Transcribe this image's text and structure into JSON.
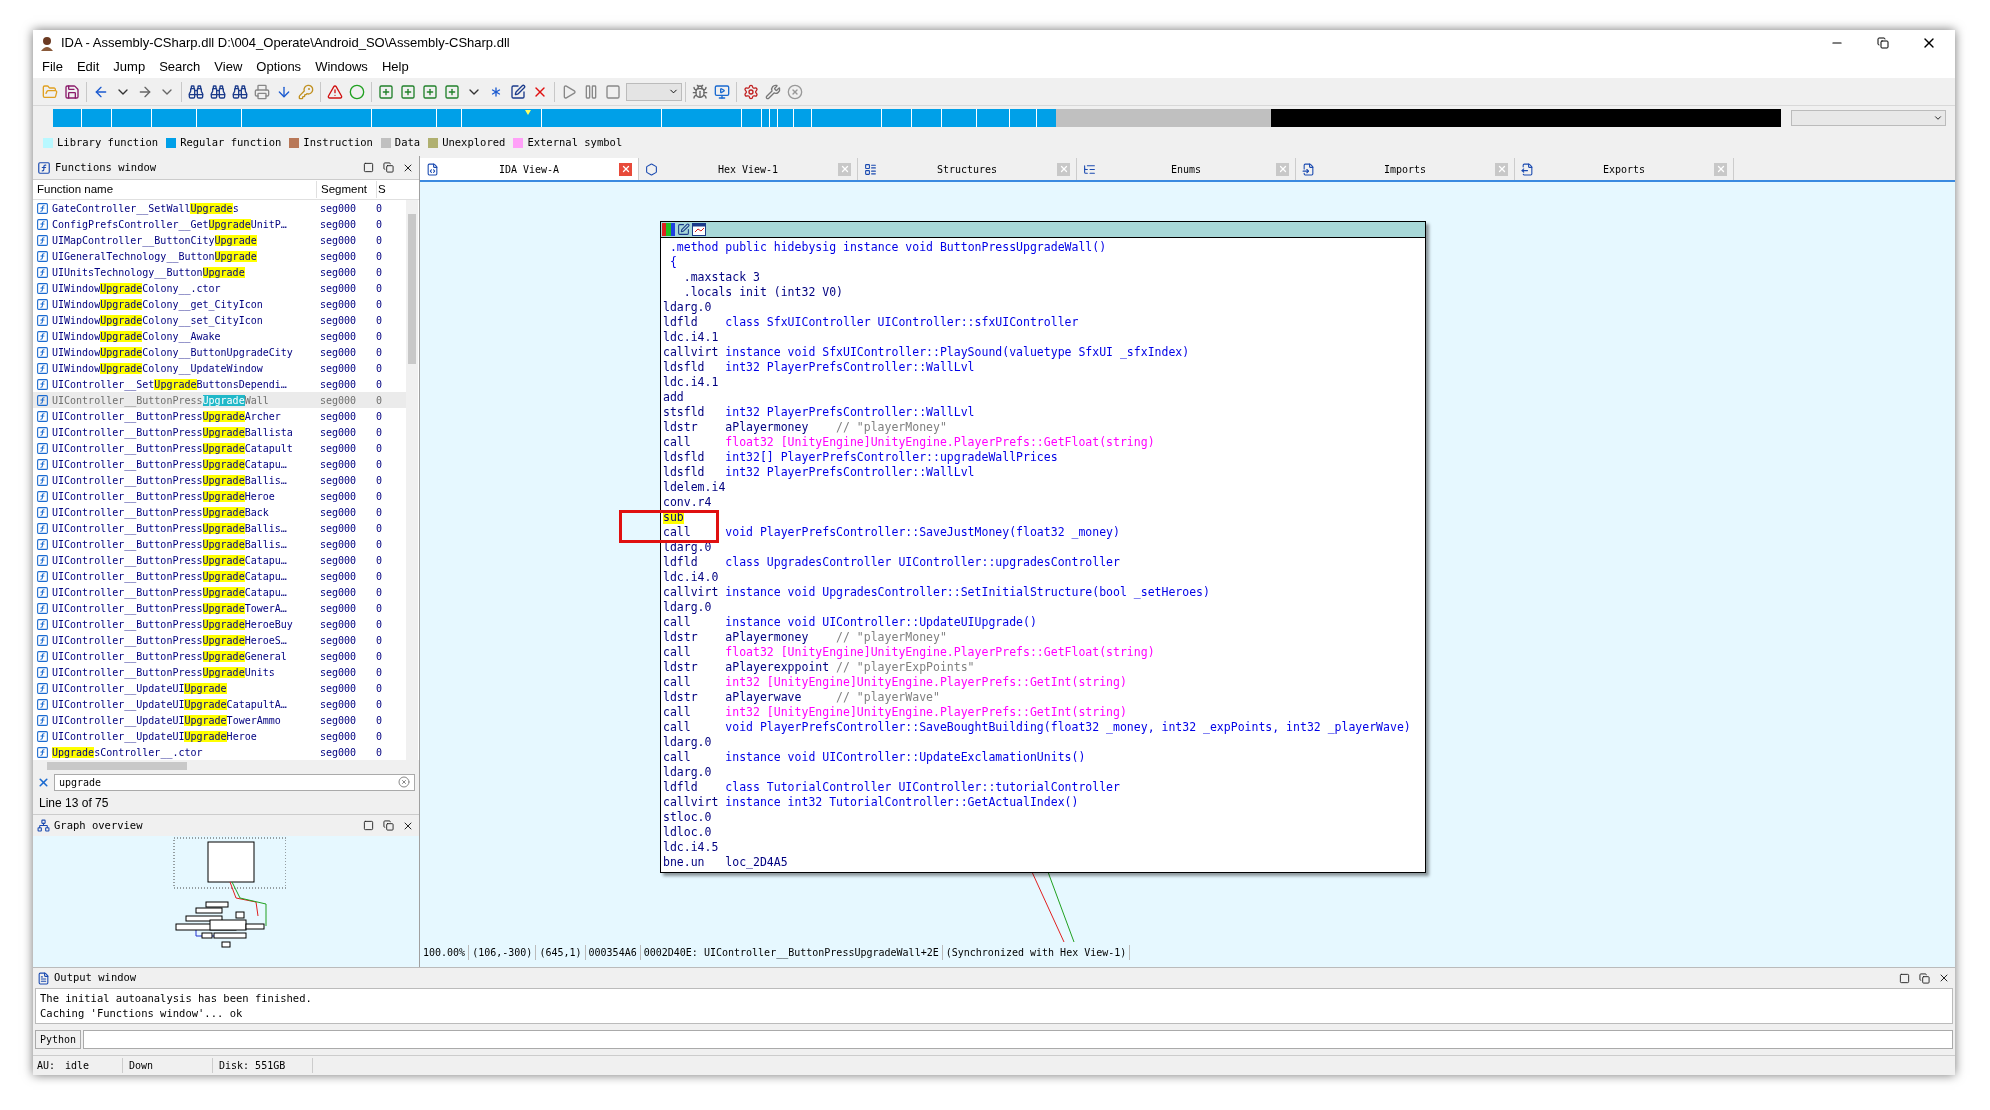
{
  "window": {
    "title": "IDA - Assembly-CSharp.dll D:\\004_Operate\\Android_SO\\Assembly-CSharp.dll"
  },
  "menu": [
    "File",
    "Edit",
    "Jump",
    "Search",
    "View",
    "Options",
    "Windows",
    "Help"
  ],
  "legend": [
    {
      "label": "Library function",
      "color": "#b8f8ff"
    },
    {
      "label": "Regular function",
      "color": "#00a0e8"
    },
    {
      "label": "Instruction",
      "color": "#b87858"
    },
    {
      "label": "Data",
      "color": "#c0c0c0"
    },
    {
      "label": "Unexplored",
      "color": "#b0b070"
    },
    {
      "label": "External symbol",
      "color": "#ffa0f8"
    }
  ],
  "functions_window": {
    "title": "Functions window",
    "columns": [
      "Function name",
      "Segment",
      "S"
    ],
    "rows": [
      {
        "parts": [
          {
            "text": "GateController__SetWall",
            "match": false
          },
          {
            "text": "Upgrade",
            "match": true
          },
          {
            "text": "s",
            "match": false
          }
        ],
        "segment": "seg000",
        "column_3": "0",
        "selected": false
      },
      {
        "parts": [
          {
            "text": "ConfigPrefsController__Get",
            "match": false
          },
          {
            "text": "Upgrade",
            "match": true
          },
          {
            "text": "UnitP…",
            "match": false
          }
        ],
        "segment": "seg000",
        "column_3": "0",
        "selected": false
      },
      {
        "parts": [
          {
            "text": "UIMapController__ButtonCity",
            "match": false
          },
          {
            "text": "Upgrade",
            "match": true
          }
        ],
        "segment": "seg000",
        "column_3": "0",
        "selected": false
      },
      {
        "parts": [
          {
            "text": "UIGeneralTechnology__Button",
            "match": false
          },
          {
            "text": "Upgrade",
            "match": true
          }
        ],
        "segment": "seg000",
        "column_3": "0",
        "selected": false
      },
      {
        "parts": [
          {
            "text": "UIUnitsTechnology__Button",
            "match": false
          },
          {
            "text": "Upgrade",
            "match": true
          }
        ],
        "segment": "seg000",
        "column_3": "0",
        "selected": false
      },
      {
        "parts": [
          {
            "text": "UIWindow",
            "match": false
          },
          {
            "text": "Upgrade",
            "match": true
          },
          {
            "text": "Colony__.ctor",
            "match": false
          }
        ],
        "segment": "seg000",
        "column_3": "0",
        "selected": false
      },
      {
        "parts": [
          {
            "text": "UIWindow",
            "match": false
          },
          {
            "text": "Upgrade",
            "match": true
          },
          {
            "text": "Colony__get_CityIcon",
            "match": false
          }
        ],
        "segment": "seg000",
        "column_3": "0",
        "selected": false
      },
      {
        "parts": [
          {
            "text": "UIWindow",
            "match": false
          },
          {
            "text": "Upgrade",
            "match": true
          },
          {
            "text": "Colony__set_CityIcon",
            "match": false
          }
        ],
        "segment": "seg000",
        "column_3": "0",
        "selected": false
      },
      {
        "parts": [
          {
            "text": "UIWindow",
            "match": false
          },
          {
            "text": "Upgrade",
            "match": true
          },
          {
            "text": "Colony__Awake",
            "match": false
          }
        ],
        "segment": "seg000",
        "column_3": "0",
        "selected": false
      },
      {
        "parts": [
          {
            "text": "UIWindow",
            "match": false
          },
          {
            "text": "Upgrade",
            "match": true
          },
          {
            "text": "Colony__ButtonUpgradeCity",
            "match": false
          }
        ],
        "segment": "seg000",
        "column_3": "0",
        "selected": false
      },
      {
        "parts": [
          {
            "text": "UIWindow",
            "match": false
          },
          {
            "text": "Upgrade",
            "match": true
          },
          {
            "text": "Colony__UpdateWindow",
            "match": false
          }
        ],
        "segment": "seg000",
        "column_3": "0",
        "selected": false
      },
      {
        "parts": [
          {
            "text": "UIController__Set",
            "match": false
          },
          {
            "text": "Upgrade",
            "match": true
          },
          {
            "text": "ButtonsDependi…",
            "match": false
          }
        ],
        "segment": "seg000",
        "column_3": "0",
        "selected": false
      },
      {
        "parts": [
          {
            "text": "UIController__ButtonPress",
            "match": false
          },
          {
            "text": "Upgrade",
            "match": true
          },
          {
            "text": "Wall",
            "match": false
          }
        ],
        "segment": "seg000",
        "column_3": "0",
        "selected": true
      },
      {
        "parts": [
          {
            "text": "UIController__ButtonPress",
            "match": false
          },
          {
            "text": "Upgrade",
            "match": true
          },
          {
            "text": "Archer",
            "match": false
          }
        ],
        "segment": "seg000",
        "column_3": "0",
        "selected": false
      },
      {
        "parts": [
          {
            "text": "UIController__ButtonPress",
            "match": false
          },
          {
            "text": "Upgrade",
            "match": true
          },
          {
            "text": "Ballista",
            "match": false
          }
        ],
        "segment": "seg000",
        "column_3": "0",
        "selected": false
      },
      {
        "parts": [
          {
            "text": "UIController__ButtonPress",
            "match": false
          },
          {
            "text": "Upgrade",
            "match": true
          },
          {
            "text": "Catapult",
            "match": false
          }
        ],
        "segment": "seg000",
        "column_3": "0",
        "selected": false
      },
      {
        "parts": [
          {
            "text": "UIController__ButtonPress",
            "match": false
          },
          {
            "text": "Upgrade",
            "match": true
          },
          {
            "text": "Catapu…",
            "match": false
          }
        ],
        "segment": "seg000",
        "column_3": "0",
        "selected": false
      },
      {
        "parts": [
          {
            "text": "UIController__ButtonPress",
            "match": false
          },
          {
            "text": "Upgrade",
            "match": true
          },
          {
            "text": "Ballis…",
            "match": false
          }
        ],
        "segment": "seg000",
        "column_3": "0",
        "selected": false
      },
      {
        "parts": [
          {
            "text": "UIController__ButtonPress",
            "match": false
          },
          {
            "text": "Upgrade",
            "match": true
          },
          {
            "text": "Heroe",
            "match": false
          }
        ],
        "segment": "seg000",
        "column_3": "0",
        "selected": false
      },
      {
        "parts": [
          {
            "text": "UIController__ButtonPress",
            "match": false
          },
          {
            "text": "Upgrade",
            "match": true
          },
          {
            "text": "Back",
            "match": false
          }
        ],
        "segment": "seg000",
        "column_3": "0",
        "selected": false
      },
      {
        "parts": [
          {
            "text": "UIController__ButtonPress",
            "match": false
          },
          {
            "text": "Upgrade",
            "match": true
          },
          {
            "text": "Ballis…",
            "match": false
          }
        ],
        "segment": "seg000",
        "column_3": "0",
        "selected": false
      },
      {
        "parts": [
          {
            "text": "UIController__ButtonPress",
            "match": false
          },
          {
            "text": "Upgrade",
            "match": true
          },
          {
            "text": "Ballis…",
            "match": false
          }
        ],
        "segment": "seg000",
        "column_3": "0",
        "selected": false
      },
      {
        "parts": [
          {
            "text": "UIController__ButtonPress",
            "match": false
          },
          {
            "text": "Upgrade",
            "match": true
          },
          {
            "text": "Catapu…",
            "match": false
          }
        ],
        "segment": "seg000",
        "column_3": "0",
        "selected": false
      },
      {
        "parts": [
          {
            "text": "UIController__ButtonPress",
            "match": false
          },
          {
            "text": "Upgrade",
            "match": true
          },
          {
            "text": "Catapu…",
            "match": false
          }
        ],
        "segment": "seg000",
        "column_3": "0",
        "selected": false
      },
      {
        "parts": [
          {
            "text": "UIController__ButtonPress",
            "match": false
          },
          {
            "text": "Upgrade",
            "match": true
          },
          {
            "text": "Catapu…",
            "match": false
          }
        ],
        "segment": "seg000",
        "column_3": "0",
        "selected": false
      },
      {
        "parts": [
          {
            "text": "UIController__ButtonPress",
            "match": false
          },
          {
            "text": "Upgrade",
            "match": true
          },
          {
            "text": "TowerA…",
            "match": false
          }
        ],
        "segment": "seg000",
        "column_3": "0",
        "selected": false
      },
      {
        "parts": [
          {
            "text": "UIController__ButtonPress",
            "match": false
          },
          {
            "text": "Upgrade",
            "match": true
          },
          {
            "text": "HeroeBuy",
            "match": false
          }
        ],
        "segment": "seg000",
        "column_3": "0",
        "selected": false
      },
      {
        "parts": [
          {
            "text": "UIController__ButtonPress",
            "match": false
          },
          {
            "text": "Upgrade",
            "match": true
          },
          {
            "text": "HeroeS…",
            "match": false
          }
        ],
        "segment": "seg000",
        "column_3": "0",
        "selected": false
      },
      {
        "parts": [
          {
            "text": "UIController__ButtonPress",
            "match": false
          },
          {
            "text": "Upgrade",
            "match": true
          },
          {
            "text": "General",
            "match": false
          }
        ],
        "segment": "seg000",
        "column_3": "0",
        "selected": false
      },
      {
        "parts": [
          {
            "text": "UIController__ButtonPress",
            "match": false
          },
          {
            "text": "Upgrade",
            "match": true
          },
          {
            "text": "Units",
            "match": false
          }
        ],
        "segment": "seg000",
        "column_3": "0",
        "selected": false
      },
      {
        "parts": [
          {
            "text": "UIController__UpdateUI",
            "match": false
          },
          {
            "text": "Upgrade",
            "match": true
          }
        ],
        "segment": "seg000",
        "column_3": "0",
        "selected": false
      },
      {
        "parts": [
          {
            "text": "UIController__UpdateUI",
            "match": false
          },
          {
            "text": "Upgrade",
            "match": true
          },
          {
            "text": "CatapultA…",
            "match": false
          }
        ],
        "segment": "seg000",
        "column_3": "0",
        "selected": false
      },
      {
        "parts": [
          {
            "text": "UIController__UpdateUI",
            "match": false
          },
          {
            "text": "Upgrade",
            "match": true
          },
          {
            "text": "TowerAmmo",
            "match": false
          }
        ],
        "segment": "seg000",
        "column_3": "0",
        "selected": false
      },
      {
        "parts": [
          {
            "text": "UIController__UpdateUI",
            "match": false
          },
          {
            "text": "Upgrade",
            "match": true
          },
          {
            "text": "Heroe",
            "match": false
          }
        ],
        "segment": "seg000",
        "column_3": "0",
        "selected": false
      },
      {
        "parts": [
          {
            "text": "Upgrade",
            "match": true
          },
          {
            "text": "sController__.ctor",
            "match": false
          }
        ],
        "segment": "seg000",
        "column_3": "0",
        "selected": false
      }
    ],
    "search": "upgrade",
    "line_info": "Line 13 of 75"
  },
  "graph_overview": {
    "title": "Graph overview"
  },
  "tabs": [
    {
      "label": "IDA View-A",
      "selected": true
    },
    {
      "label": "Hex View-1",
      "selected": false
    },
    {
      "label": "Structures",
      "selected": false
    },
    {
      "label": "Enums",
      "selected": false
    },
    {
      "label": "Imports",
      "selected": false
    },
    {
      "label": "Exports",
      "selected": false
    }
  ],
  "code": {
    "lines": [
      {
        "kind": "header",
        "text": " .method public hidebysig instance void ButtonPressUpgradeWall()",
        "color": "#0000e6"
      },
      {
        "kind": "header",
        "text": " {",
        "color": "#0000e6"
      },
      {
        "kind": "header",
        "text": "   .maxstack 3",
        "color": "#000080"
      },
      {
        "kind": "header",
        "text": "   .locals init (int32 V0)",
        "color": "#000080"
      },
      {
        "kind": "instr",
        "op": "ldarg.0",
        "highlighted": false
      },
      {
        "kind": "instr",
        "op": "ldfld",
        "arg": {
          "text": "class SfxUIController UIController::sfxUIController",
          "color": "#0000e6"
        },
        "highlighted": false
      },
      {
        "kind": "instr",
        "op": "ldc.i4.1",
        "highlighted": false
      },
      {
        "kind": "instr",
        "op": "callvirt",
        "arg": {
          "text": "instance void SfxUIController::PlaySound(valuetype SfxUI _sfxIndex)",
          "color": "#0000e6"
        },
        "highlighted": false
      },
      {
        "kind": "instr",
        "op": "ldsfld",
        "arg": {
          "text": "int32 PlayerPrefsController::WallLvl",
          "color": "#0000e6"
        },
        "highlighted": false
      },
      {
        "kind": "instr",
        "op": "ldc.i4.1",
        "highlighted": false
      },
      {
        "kind": "instr",
        "op": "add",
        "highlighted": false
      },
      {
        "kind": "instr",
        "op": "stsfld",
        "arg": {
          "text": "int32 PlayerPrefsController::WallLvl",
          "color": "#0000e6"
        },
        "highlighted": false
      },
      {
        "kind": "instr",
        "op": "ldstr",
        "arg": {
          "text": "aPlayermoney",
          "color": "#000080"
        },
        "comment": "// \"playerMoney\"",
        "highlighted": false
      },
      {
        "kind": "instr",
        "op": "call",
        "arg": {
          "text": "float32 [UnityEngine]UnityEngine.PlayerPrefs::GetFloat(string)",
          "color": "#ff00ff"
        },
        "highlighted": false
      },
      {
        "kind": "instr",
        "op": "ldsfld",
        "arg": {
          "text": "int32[] PlayerPrefsController::upgradeWallPrices",
          "color": "#0000e6"
        },
        "highlighted": false
      },
      {
        "kind": "instr",
        "op": "ldsfld",
        "arg": {
          "text": "int32 PlayerPrefsController::WallLvl",
          "color": "#0000e6"
        },
        "highlighted": false
      },
      {
        "kind": "instr",
        "op": "ldelem.i4",
        "highlighted": false
      },
      {
        "kind": "instr",
        "op": "conv.r4",
        "highlighted": false
      },
      {
        "kind": "instr",
        "op": "sub",
        "highlighted": true
      },
      {
        "kind": "instr",
        "op": "call",
        "arg": {
          "text": "void PlayerPrefsController::SaveJustMoney(float32 _money)",
          "color": "#0000e6"
        },
        "highlighted": false
      },
      {
        "kind": "instr",
        "op": "ldarg.0",
        "highlighted": false
      },
      {
        "kind": "instr",
        "op": "ldfld",
        "arg": {
          "text": "class UpgradesController UIController::upgradesController",
          "color": "#0000e6"
        },
        "highlighted": false
      },
      {
        "kind": "instr",
        "op": "ldc.i4.0",
        "highlighted": false
      },
      {
        "kind": "instr",
        "op": "callvirt",
        "arg": {
          "text": "instance void UpgradesController::SetInitialStructure(bool _setHeroes)",
          "color": "#0000e6"
        },
        "highlighted": false
      },
      {
        "kind": "instr",
        "op": "ldarg.0",
        "highlighted": false
      },
      {
        "kind": "instr",
        "op": "call",
        "arg": {
          "text": "instance void UIController::UpdateUIUpgrade()",
          "color": "#0000e6"
        },
        "highlighted": false
      },
      {
        "kind": "instr",
        "op": "ldstr",
        "arg": {
          "text": "aPlayermoney",
          "color": "#000080"
        },
        "comment": "// \"playerMoney\"",
        "highlighted": false
      },
      {
        "kind": "instr",
        "op": "call",
        "arg": {
          "text": "float32 [UnityEngine]UnityEngine.PlayerPrefs::GetFloat(string)",
          "color": "#ff00ff"
        },
        "highlighted": false
      },
      {
        "kind": "instr",
        "op": "ldstr",
        "arg": {
          "text": "aPlayerexppoint",
          "color": "#000080"
        },
        "comment": "// \"playerExpPoints\"",
        "highlighted": false
      },
      {
        "kind": "instr",
        "op": "call",
        "arg": {
          "text": "int32 [UnityEngine]UnityEngine.PlayerPrefs::GetInt(string)",
          "color": "#ff00ff"
        },
        "highlighted": false
      },
      {
        "kind": "instr",
        "op": "ldstr",
        "arg": {
          "text": "aPlayerwave",
          "color": "#000080"
        },
        "comment": "// \"playerWave\"",
        "highlighted": false
      },
      {
        "kind": "instr",
        "op": "call",
        "arg": {
          "text": "int32 [UnityEngine]UnityEngine.PlayerPrefs::GetInt(string)",
          "color": "#ff00ff"
        },
        "highlighted": false
      },
      {
        "kind": "instr",
        "op": "call",
        "arg": {
          "text": "void PlayerPrefsController::SaveBoughtBuilding(float32 _money, int32 _expPoints, int32 _playerWave)",
          "color": "#0000e6"
        },
        "highlighted": false
      },
      {
        "kind": "instr",
        "op": "ldarg.0",
        "highlighted": false
      },
      {
        "kind": "instr",
        "op": "call",
        "arg": {
          "text": "instance void UIController::UpdateExclamationUnits()",
          "color": "#0000e6"
        },
        "highlighted": false
      },
      {
        "kind": "instr",
        "op": "ldarg.0",
        "highlighted": false
      },
      {
        "kind": "instr",
        "op": "ldfld",
        "arg": {
          "text": "class TutorialController UIController::tutorialController",
          "color": "#0000e6"
        },
        "highlighted": false
      },
      {
        "kind": "instr",
        "op": "callvirt",
        "arg": {
          "text": "instance int32 TutorialController::GetActualIndex()",
          "color": "#0000e6"
        },
        "highlighted": false
      },
      {
        "kind": "instr",
        "op": "stloc.0",
        "highlighted": false
      },
      {
        "kind": "instr",
        "op": "ldloc.0",
        "highlighted": false
      },
      {
        "kind": "instr",
        "op": "ldc.i4.5",
        "highlighted": false
      },
      {
        "kind": "instr",
        "op": "bne.un",
        "arg": {
          "text": "loc_2D4A5",
          "color": "#000080"
        },
        "highlighted": false
      }
    ]
  },
  "view_status": [
    "100.00%",
    "(106,-300)",
    "(645,1)",
    "000354A6",
    "0002D40E: UIController__ButtonPressUpgradeWall+2E",
    "(Synchronized with Hex View-1)"
  ],
  "output_window": {
    "title": "Output window",
    "lines": [
      "The initial autoanalysis has been finished.",
      "Caching 'Functions window'... ok"
    ],
    "language_button": "Python"
  },
  "status_bar": {
    "au_label": "AU:",
    "au_state": "idle",
    "direction": "Down",
    "disk": "Disk: 551GB"
  }
}
